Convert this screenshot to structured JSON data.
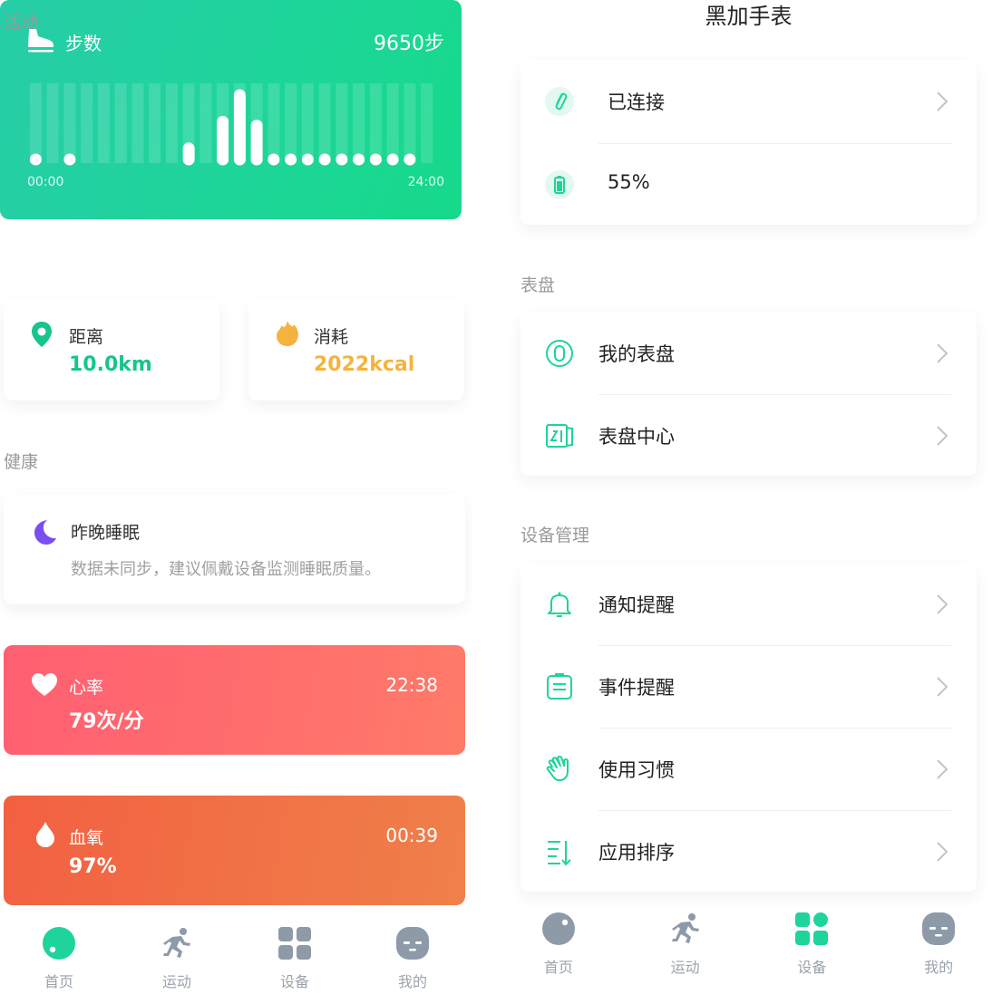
{
  "left": {
    "activity_label": "活动",
    "steps": {
      "title": "步数",
      "value": "9650步",
      "start": "00:00",
      "end": "24:00",
      "levels": [
        0.05,
        0,
        0.05,
        0,
        0,
        0,
        0,
        0,
        0,
        0.3,
        0,
        0.65,
        1.0,
        0.6,
        0.05,
        0.05,
        0.05,
        0.05,
        0.05,
        0.05,
        0.05,
        0.05,
        0.05,
        0
      ]
    },
    "distance": {
      "label": "距离",
      "value": "10.0km"
    },
    "calories": {
      "label": "消耗",
      "value": "2022kcal"
    },
    "health_label": "健康",
    "sleep": {
      "label": "昨晚睡眠",
      "note": "数据未同步，建议佩戴设备监测睡眠质量。"
    },
    "heart": {
      "label": "心率",
      "value": "79次/分",
      "time": "22:38"
    },
    "oxygen": {
      "label": "血氧",
      "value": "97%",
      "time": "00:39"
    },
    "tabs": [
      "首页",
      "运动",
      "设备",
      "我的"
    ]
  },
  "right": {
    "title": "黑加手表",
    "status": {
      "connected": "已连接",
      "battery": "55%"
    },
    "dial_label": "表盘",
    "dials": [
      "我的表盘",
      "表盘中心"
    ],
    "device_label": "设备管理",
    "device": [
      "通知提醒",
      "事件提醒",
      "使用习惯",
      "应用排序"
    ],
    "tabs": [
      "首页",
      "运动",
      "设备",
      "我的"
    ]
  },
  "colors": {
    "green": "#1fd39c",
    "distance": "#17c48e",
    "calorie": "#f5b33d",
    "moon": "#7a4ff0",
    "tab_gray": "#8e9aa8"
  }
}
